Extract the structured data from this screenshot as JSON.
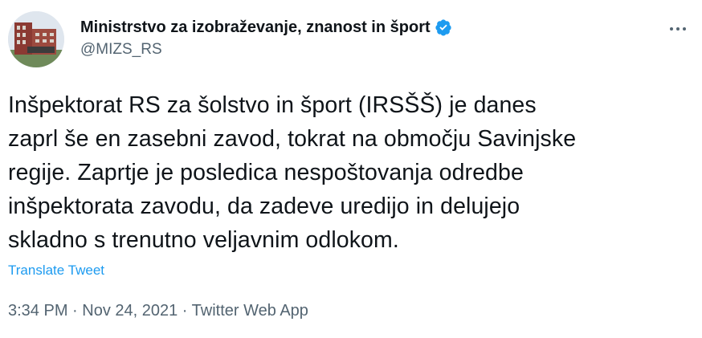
{
  "account": {
    "display_name": "Ministrstvo za izobraževanje, znanost in šport",
    "handle": "@MIZS_RS",
    "avatar_icon": "building-avatar",
    "verified_icon": "verified-badge-icon",
    "verified_color": "#1d9bf0"
  },
  "tweet": {
    "lines": [
      "Inšpektorat RS za šolstvo in šport (IRSŠŠ) je danes",
      "zaprl še en zasebni zavod, tokrat na območju Savinjske",
      "regije. Zaprtje je posledica nespoštovanja odredbe",
      "inšpektorata zavodu, da zadeve uredijo in delujejo",
      "skladno s trenutno veljavnim odlokom."
    ],
    "translate_label": "Translate Tweet"
  },
  "meta": {
    "time": "3:34 PM",
    "separator1": " · ",
    "date": "Nov 24, 2021",
    "separator2": " · ",
    "source": "Twitter Web App"
  },
  "menu": {
    "more_icon": "more-options-icon"
  },
  "colors": {
    "text": "#0f1419",
    "secondary": "#536471",
    "link": "#1d9bf0"
  }
}
